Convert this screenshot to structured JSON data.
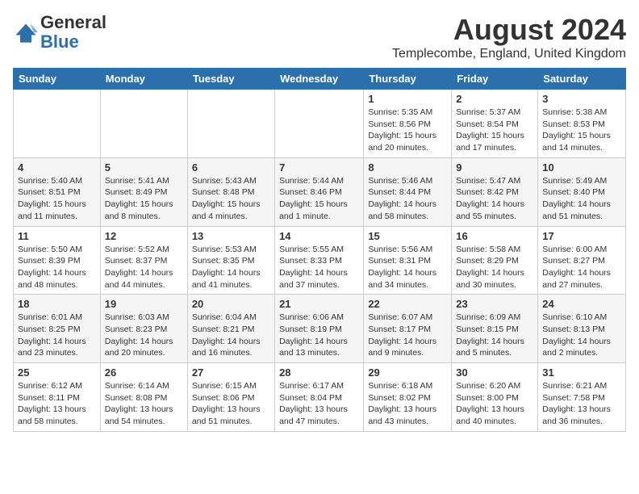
{
  "logo": {
    "general": "General",
    "blue": "Blue"
  },
  "title": {
    "month_year": "August 2024",
    "location": "Templecombe, England, United Kingdom"
  },
  "calendar": {
    "headers": [
      "Sunday",
      "Monday",
      "Tuesday",
      "Wednesday",
      "Thursday",
      "Friday",
      "Saturday"
    ],
    "weeks": [
      [
        {
          "day": "",
          "info": ""
        },
        {
          "day": "",
          "info": ""
        },
        {
          "day": "",
          "info": ""
        },
        {
          "day": "",
          "info": ""
        },
        {
          "day": "1",
          "info": "Sunrise: 5:35 AM\nSunset: 8:56 PM\nDaylight: 15 hours and 20 minutes."
        },
        {
          "day": "2",
          "info": "Sunrise: 5:37 AM\nSunset: 8:54 PM\nDaylight: 15 hours and 17 minutes."
        },
        {
          "day": "3",
          "info": "Sunrise: 5:38 AM\nSunset: 8:53 PM\nDaylight: 15 hours and 14 minutes."
        }
      ],
      [
        {
          "day": "4",
          "info": "Sunrise: 5:40 AM\nSunset: 8:51 PM\nDaylight: 15 hours and 11 minutes."
        },
        {
          "day": "5",
          "info": "Sunrise: 5:41 AM\nSunset: 8:49 PM\nDaylight: 15 hours and 8 minutes."
        },
        {
          "day": "6",
          "info": "Sunrise: 5:43 AM\nSunset: 8:48 PM\nDaylight: 15 hours and 4 minutes."
        },
        {
          "day": "7",
          "info": "Sunrise: 5:44 AM\nSunset: 8:46 PM\nDaylight: 15 hours and 1 minute."
        },
        {
          "day": "8",
          "info": "Sunrise: 5:46 AM\nSunset: 8:44 PM\nDaylight: 14 hours and 58 minutes."
        },
        {
          "day": "9",
          "info": "Sunrise: 5:47 AM\nSunset: 8:42 PM\nDaylight: 14 hours and 55 minutes."
        },
        {
          "day": "10",
          "info": "Sunrise: 5:49 AM\nSunset: 8:40 PM\nDaylight: 14 hours and 51 minutes."
        }
      ],
      [
        {
          "day": "11",
          "info": "Sunrise: 5:50 AM\nSunset: 8:39 PM\nDaylight: 14 hours and 48 minutes."
        },
        {
          "day": "12",
          "info": "Sunrise: 5:52 AM\nSunset: 8:37 PM\nDaylight: 14 hours and 44 minutes."
        },
        {
          "day": "13",
          "info": "Sunrise: 5:53 AM\nSunset: 8:35 PM\nDaylight: 14 hours and 41 minutes."
        },
        {
          "day": "14",
          "info": "Sunrise: 5:55 AM\nSunset: 8:33 PM\nDaylight: 14 hours and 37 minutes."
        },
        {
          "day": "15",
          "info": "Sunrise: 5:56 AM\nSunset: 8:31 PM\nDaylight: 14 hours and 34 minutes."
        },
        {
          "day": "16",
          "info": "Sunrise: 5:58 AM\nSunset: 8:29 PM\nDaylight: 14 hours and 30 minutes."
        },
        {
          "day": "17",
          "info": "Sunrise: 6:00 AM\nSunset: 8:27 PM\nDaylight: 14 hours and 27 minutes."
        }
      ],
      [
        {
          "day": "18",
          "info": "Sunrise: 6:01 AM\nSunset: 8:25 PM\nDaylight: 14 hours and 23 minutes."
        },
        {
          "day": "19",
          "info": "Sunrise: 6:03 AM\nSunset: 8:23 PM\nDaylight: 14 hours and 20 minutes."
        },
        {
          "day": "20",
          "info": "Sunrise: 6:04 AM\nSunset: 8:21 PM\nDaylight: 14 hours and 16 minutes."
        },
        {
          "day": "21",
          "info": "Sunrise: 6:06 AM\nSunset: 8:19 PM\nDaylight: 14 hours and 13 minutes."
        },
        {
          "day": "22",
          "info": "Sunrise: 6:07 AM\nSunset: 8:17 PM\nDaylight: 14 hours and 9 minutes."
        },
        {
          "day": "23",
          "info": "Sunrise: 6:09 AM\nSunset: 8:15 PM\nDaylight: 14 hours and 5 minutes."
        },
        {
          "day": "24",
          "info": "Sunrise: 6:10 AM\nSunset: 8:13 PM\nDaylight: 14 hours and 2 minutes."
        }
      ],
      [
        {
          "day": "25",
          "info": "Sunrise: 6:12 AM\nSunset: 8:11 PM\nDaylight: 13 hours and 58 minutes."
        },
        {
          "day": "26",
          "info": "Sunrise: 6:14 AM\nSunset: 8:08 PM\nDaylight: 13 hours and 54 minutes."
        },
        {
          "day": "27",
          "info": "Sunrise: 6:15 AM\nSunset: 8:06 PM\nDaylight: 13 hours and 51 minutes."
        },
        {
          "day": "28",
          "info": "Sunrise: 6:17 AM\nSunset: 8:04 PM\nDaylight: 13 hours and 47 minutes."
        },
        {
          "day": "29",
          "info": "Sunrise: 6:18 AM\nSunset: 8:02 PM\nDaylight: 13 hours and 43 minutes."
        },
        {
          "day": "30",
          "info": "Sunrise: 6:20 AM\nSunset: 8:00 PM\nDaylight: 13 hours and 40 minutes."
        },
        {
          "day": "31",
          "info": "Sunrise: 6:21 AM\nSunset: 7:58 PM\nDaylight: 13 hours and 36 minutes."
        }
      ]
    ]
  }
}
